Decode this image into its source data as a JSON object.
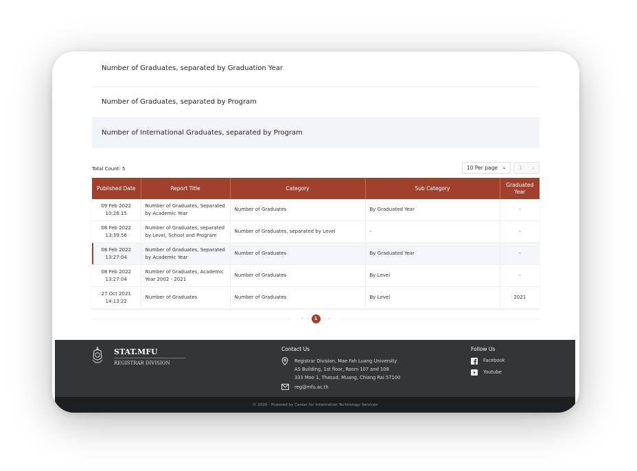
{
  "reports": [
    {
      "label": "Number of Graduates, separated by Graduation Year"
    },
    {
      "label": "Number of Graduates, separated by Program"
    },
    {
      "label": "Number of International Graduates, separated by Program"
    }
  ],
  "listing": {
    "total_count": "Total Count: 5",
    "per_page": "10 Per page",
    "page_select": "1",
    "columns": [
      "Published Date",
      "Report Title",
      "Category",
      "Sub Category",
      "Graduated Year"
    ],
    "rows": [
      {
        "date": "09 Feb 2022",
        "time": "10:26:15",
        "title": "Number of Graduates, Separated by Academic Year",
        "category": "Number of Graduates",
        "sub": "By Graduated Year",
        "year": "-"
      },
      {
        "date": "08 Feb 2022",
        "time": "13:39:56",
        "title": "Number of Graduates, separated by Level, School and Program",
        "category": "Number of Graduates, separated by Level",
        "sub": "-",
        "year": "-"
      },
      {
        "date": "08 Feb 2022",
        "time": "13:27:04",
        "title": "Number of Graduates, Separated by Academic Year",
        "category": "Number of Graduates",
        "sub": "By Graduated Year",
        "year": "-"
      },
      {
        "date": "08 Feb 2022",
        "time": "13:27:04",
        "title": "Number of Graduates, Academic Year 2002 - 2021",
        "category": "Number of Graduates",
        "sub": "By Level",
        "year": "-"
      },
      {
        "date": "27 Oct 2021",
        "time": "14:13:22",
        "title": "Number of Graduates",
        "category": "Number of Graduates",
        "sub": "By Level",
        "year": "2021"
      }
    ],
    "pagination": {
      "first": "«",
      "prev": "‹",
      "current": "1",
      "next": "›",
      "last": "»"
    }
  },
  "footer": {
    "brand_name": "STAT.MFU",
    "brand_division": "REGISTRAR DIVISION",
    "contact_title": "Contact Us",
    "address_lines": [
      "Registrar Division, Mae Fah Luang University",
      "AS Building, 1st floor, Room 107 and 108",
      "333 Moo 1, Thasud, Muang, Chiang Rai 57100"
    ],
    "email": "reg@mfu.ac.th",
    "follow_title": "Follow Us",
    "facebook": "Facebook",
    "youtube": "Youtube",
    "copyright": "© 2020 - Powered by Center for Information Technology Services"
  },
  "icons": {
    "logo": "university-emblem-icon",
    "address": "map-pin-icon",
    "email": "envelope-icon",
    "facebook": "facebook-icon",
    "youtube": "youtube-icon",
    "dropdown": "chevron-down-icon"
  },
  "colors": {
    "accent": "#a1402d",
    "footer_bg": "#333537",
    "footer_bottom": "#1d1e1f"
  }
}
